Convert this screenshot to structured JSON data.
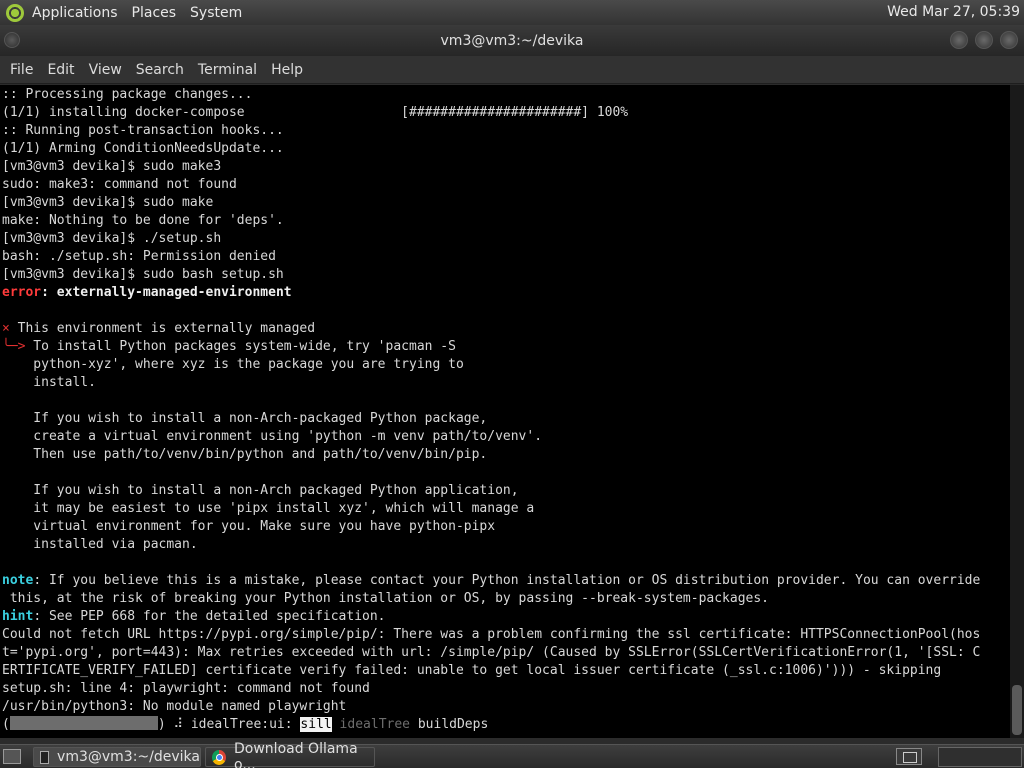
{
  "top_panel": {
    "menus": [
      "Applications",
      "Places",
      "System"
    ],
    "clock": "Wed Mar 27, 05:39"
  },
  "window": {
    "title": "vm3@vm3:~/devika"
  },
  "menubar": [
    "File",
    "Edit",
    "View",
    "Search",
    "Terminal",
    "Help"
  ],
  "terminal": {
    "lines": [
      ":: Processing package changes...",
      "(1/1) installing docker-compose                    [######################] 100%",
      ":: Running post-transaction hooks...",
      "(1/1) Arming ConditionNeedsUpdate...",
      "[vm3@vm3 devika]$ sudo make3",
      "sudo: make3: command not found",
      "[vm3@vm3 devika]$ sudo make",
      "make: Nothing to be done for 'deps'.",
      "[vm3@vm3 devika]$ ./setup.sh",
      "bash: ./setup.sh: Permission denied",
      "[vm3@vm3 devika]$ sudo bash setup.sh"
    ],
    "error_label": "error",
    "error_text": ": externally-managed-environment",
    "env_glyph": "×",
    "env_line": " This environment is externally managed",
    "arrow_glyph": "╰─>",
    "env_body": [
      " To install Python packages system-wide, try 'pacman -S",
      "    python-xyz', where xyz is the package you are trying to",
      "    install.",
      "",
      "    If you wish to install a non-Arch-packaged Python package,",
      "    create a virtual environment using 'python -m venv path/to/venv'.",
      "    Then use path/to/venv/bin/python and path/to/venv/bin/pip.",
      "",
      "    If you wish to install a non-Arch packaged Python application,",
      "    it may be easiest to use 'pipx install xyz', which will manage a",
      "    virtual environment for you. Make sure you have python-pipx",
      "    installed via pacman."
    ],
    "note_label": "note",
    "note_lines": [
      ": If you believe this is a mistake, please contact your Python installation or OS distribution provider. You can override",
      " this, at the risk of breaking your Python installation or OS, by passing --break-system-packages."
    ],
    "hint_label": "hint",
    "hint_text": ": See PEP 668 for the detailed specification.",
    "tail_lines": [
      "Could not fetch URL https://pypi.org/simple/pip/: There was a problem confirming the ssl certificate: HTTPSConnectionPool(hos",
      "t='pypi.org', port=443): Max retries exceeded with url: /simple/pip/ (Caused by SSLError(SSLCertVerificationError(1, '[SSL: C",
      "ERTIFICATE_VERIFY_FAILED] certificate verify failed: unable to get local issuer certificate (_ssl.c:1006)'))) - skipping",
      "setup.sh: line 4: playwright: command not found",
      "/usr/bin/python3: No module named playwright"
    ],
    "progress": {
      "open_paren": "(",
      "close_part": ") ",
      "spinner": "⠼",
      "label": " idealTree:ui: ",
      "sill": "sill",
      "idealtree": " idealTree",
      "builddeps": " buildDeps"
    }
  },
  "taskbar": {
    "tasks": [
      "vm3@vm3:~/devika",
      "Download Ollama o..."
    ]
  }
}
